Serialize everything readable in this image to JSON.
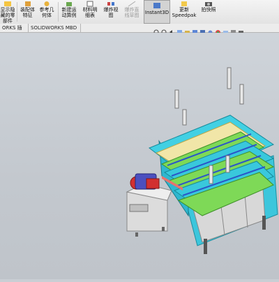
{
  "ribbon": {
    "hidden_parts_label": "显示隐\n藏的零\n部件",
    "assembly_feature_label": "装配体\n特征",
    "reference_geometry_label": "参考几\n何体",
    "new_motion_study_label": "新建运\n动算例",
    "bom_label": "材料明\n细表",
    "exploded_view_label": "爆炸视\n图",
    "explode_line_sketch_label": "爆炸直\n线草图",
    "instant3d_label": "Instant3D",
    "update_speedpak_label": "更新\nSpeedpak",
    "snapshot_label": "拍快照"
  },
  "tabs": [
    {
      "label": "ORKS 插件"
    },
    {
      "label": "SOLIDWORKS MBD"
    }
  ],
  "heads_up_toolbar": {
    "icons": [
      "zoom-fit-icon",
      "zoom-area-icon",
      "previous-view-icon",
      "section-view-icon",
      "dynamic-annotation-icon",
      "view-orientation-icon",
      "display-style-icon",
      "hide-show-icon",
      "edit-appearance-icon",
      "apply-scene-icon",
      "view-settings-icon",
      "display-icon"
    ]
  },
  "colors": {
    "frame_cyan": "#39c8dc",
    "rail_green": "#7ed957",
    "motor_red": "#d23030",
    "cabinet_gray": "#c8c8c8"
  }
}
